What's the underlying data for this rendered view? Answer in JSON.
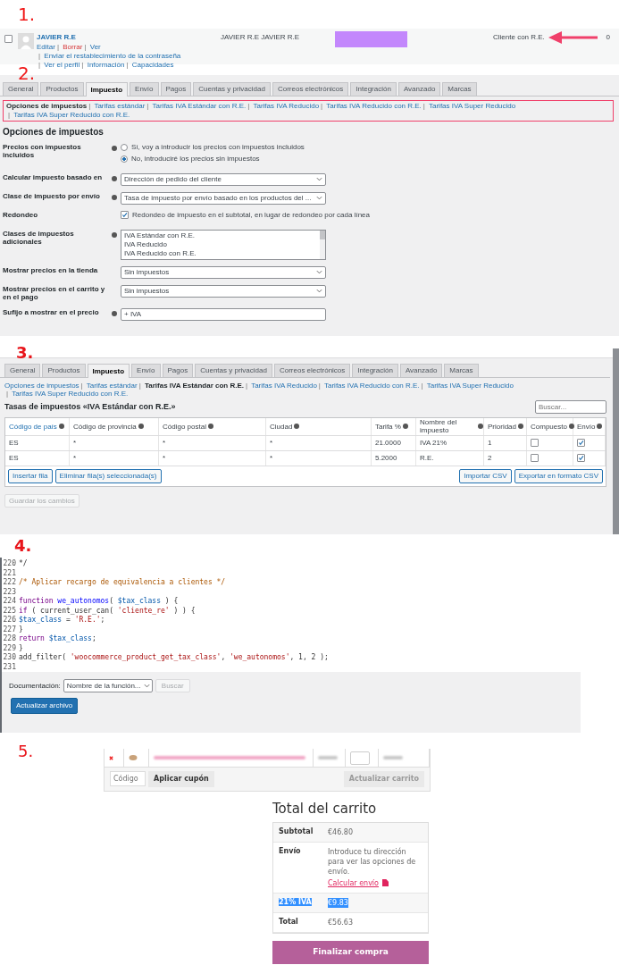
{
  "section_1": {
    "step": "1.",
    "user": {
      "selected": false,
      "name": "JAVIER R.E",
      "separator": "|",
      "actions": [
        {
          "label": "Editar",
          "kind": "link"
        },
        {
          "label": "Borrar",
          "kind": "delete"
        },
        {
          "label": "Ver",
          "kind": "link"
        },
        {
          "label": "Enviar el restablecimiento de la contraseña",
          "kind": "link"
        },
        {
          "label": "Ver el perfil",
          "kind": "link"
        },
        {
          "label": "Información",
          "kind": "link"
        },
        {
          "label": "Capacidades",
          "kind": "link"
        }
      ],
      "full_name": "JAVIER R.E JAVIER R.E",
      "role": "Cliente con R.E.",
      "posts": "0"
    }
  },
  "section_2": {
    "step": "2.",
    "tabs": [
      {
        "label": "General",
        "selected": false
      },
      {
        "label": "Productos",
        "selected": false
      },
      {
        "label": "Impuesto",
        "selected": true
      },
      {
        "label": "Envío",
        "selected": false
      },
      {
        "label": "Pagos",
        "selected": false
      },
      {
        "label": "Cuentas y privacidad",
        "selected": false
      },
      {
        "label": "Correos electrónicos",
        "selected": false
      },
      {
        "label": "Integración",
        "selected": false
      },
      {
        "label": "Avanzado",
        "selected": false
      },
      {
        "label": "Marcas",
        "selected": false
      }
    ],
    "separator": "|",
    "sublinks": [
      {
        "label": "Opciones de impuestos",
        "selected": true
      },
      {
        "label": "Tarifas estándar",
        "selected": false
      },
      {
        "label": "Tarifas IVA Estándar con R.E.",
        "selected": false
      },
      {
        "label": "Tarifas IVA Reducido",
        "selected": false
      },
      {
        "label": "Tarifas IVA Reducido con R.E.",
        "selected": false
      },
      {
        "label": "Tarifas IVA Super Reducido",
        "selected": false
      },
      {
        "label": "Tarifas IVA Super Reducido con R.E.",
        "selected": false
      }
    ],
    "heading": "Opciones de impuestos",
    "fields": [
      {
        "kind": "radio",
        "label": "Precios con impuestos incluidos",
        "help": true,
        "options": [
          {
            "label": "Sí, voy a introducir los precios con impuestos incluidos",
            "selected": false
          },
          {
            "label": "No, introduciré los precios sin impuestos",
            "selected": true
          }
        ]
      },
      {
        "kind": "select",
        "label": "Calcular impuesto basado en",
        "help": true,
        "value": "Dirección de pedido del cliente"
      },
      {
        "kind": "select",
        "label": "Clase de impuesto por envío",
        "help": true,
        "value": "Tasa de impuesto por envío basado en los productos del ..."
      },
      {
        "kind": "checkbox",
        "label": "Redondeo",
        "help": false,
        "checked": true,
        "text": "Redondeo de impuesto en el subtotal, en lugar de redondeo por cada línea"
      },
      {
        "kind": "listbox",
        "label": "Clases de impuestos adicionales",
        "help": true,
        "lines": [
          "IVA Estándar con R.E.",
          "IVA Reducido",
          "IVA Reducido con R.E."
        ]
      },
      {
        "kind": "select",
        "label": "Mostrar precios en la tienda",
        "help": false,
        "value": "Sin impuestos"
      },
      {
        "kind": "select",
        "label": "Mostrar precios en el carrito y en el pago",
        "help": false,
        "value": "Sin impuestos"
      },
      {
        "kind": "text",
        "label": "Sufijo a mostrar en el precio",
        "help": true,
        "value": "+ IVA"
      }
    ]
  },
  "section_3": {
    "step": "3.",
    "tabs": [
      {
        "label": "General",
        "selected": false
      },
      {
        "label": "Productos",
        "selected": false
      },
      {
        "label": "Impuesto",
        "selected": true
      },
      {
        "label": "Envío",
        "selected": false
      },
      {
        "label": "Pagos",
        "selected": false
      },
      {
        "label": "Cuentas y privacidad",
        "selected": false
      },
      {
        "label": "Correos electrónicos",
        "selected": false
      },
      {
        "label": "Integración",
        "selected": false
      },
      {
        "label": "Avanzado",
        "selected": false
      },
      {
        "label": "Marcas",
        "selected": false
      }
    ],
    "separator": "|",
    "sublinks": [
      {
        "label": "Opciones de impuestos",
        "selected": false
      },
      {
        "label": "Tarifas estándar",
        "selected": false
      },
      {
        "label": "Tarifas IVA Estándar con R.E.",
        "selected": true
      },
      {
        "label": "Tarifas IVA Reducido",
        "selected": false
      },
      {
        "label": "Tarifas IVA Reducido con R.E.",
        "selected": false
      },
      {
        "label": "Tarifas IVA Super Reducido",
        "selected": false
      },
      {
        "label": "Tarifas IVA Super Reducido con R.E.",
        "selected": false
      }
    ],
    "heading": "Tasas de impuestos «IVA Estándar con R.E.»",
    "search": {
      "placeholder": "Buscar..."
    },
    "table": {
      "columns": [
        {
          "label": "Código de país",
          "selected": true
        },
        {
          "label": "Código de provincia",
          "selected": false
        },
        {
          "label": "Código postal",
          "selected": false
        },
        {
          "label": "Ciudad",
          "selected": false
        },
        {
          "label": "Tarifa %",
          "selected": false
        },
        {
          "label": "Nombre del impuesto",
          "selected": false
        },
        {
          "label": "Prioridad",
          "selected": false
        },
        {
          "label": "Compuesto",
          "selected": false
        },
        {
          "label": "Envío",
          "selected": false
        }
      ],
      "rows": [
        {
          "country": "ES",
          "state": "*",
          "postcode": "*",
          "city": "*",
          "rate": "21.0000",
          "name": "IVA 21%",
          "priority": "1",
          "compound": false,
          "shipping": true
        },
        {
          "country": "ES",
          "state": "*",
          "postcode": "*",
          "city": "*",
          "rate": "5.2000",
          "name": "R.E.",
          "priority": "2",
          "compound": false,
          "shipping": true
        }
      ]
    },
    "left_buttons": [
      "Insertar fila",
      "Eliminar fila(s) seleccionada(s)"
    ],
    "right_buttons": [
      "Importar CSV",
      "Exportar en formato CSV"
    ],
    "save": {
      "label": "Guardar los cambios",
      "disabled": true
    }
  },
  "section_4": {
    "step": "4.",
    "lines": [
      {
        "number": "220",
        "tokens": [
          {
            "kind": "plain",
            "text": "*/"
          }
        ]
      },
      {
        "number": "221"
      },
      {
        "number": "222",
        "tokens": [
          {
            "kind": "comment",
            "text": "/* Aplicar recargo de equivalencia a clientes */"
          }
        ]
      },
      {
        "number": "223"
      },
      {
        "number": "224",
        "tokens": [
          {
            "kind": "keyword",
            "text": "function "
          },
          {
            "kind": "def",
            "text": "we_autonomos"
          },
          {
            "kind": "plain",
            "text": "( "
          },
          {
            "kind": "variable",
            "text": "$tax_class"
          },
          {
            "kind": "plain",
            "text": " ) {"
          }
        ]
      },
      {
        "number": "225",
        "tokens": [
          {
            "kind": "keyword",
            "text": "if"
          },
          {
            "kind": "plain",
            "text": " ( current_user_can( "
          },
          {
            "kind": "string",
            "text": "'cliente_re'"
          },
          {
            "kind": "plain",
            "text": " ) ) {"
          }
        ]
      },
      {
        "number": "226",
        "tokens": [
          {
            "kind": "variable",
            "text": "$tax_class"
          },
          {
            "kind": "plain",
            "text": " = "
          },
          {
            "kind": "string",
            "text": "'R.E.'"
          },
          {
            "kind": "plain",
            "text": ";"
          }
        ]
      },
      {
        "number": "227",
        "tokens": [
          {
            "kind": "plain",
            "text": "}"
          }
        ]
      },
      {
        "number": "228",
        "tokens": [
          {
            "kind": "keyword",
            "text": "return "
          },
          {
            "kind": "variable",
            "text": "$tax_class"
          },
          {
            "kind": "plain",
            "text": ";"
          }
        ]
      },
      {
        "number": "229",
        "tokens": [
          {
            "kind": "plain",
            "text": "}"
          }
        ]
      },
      {
        "number": "230",
        "tokens": [
          {
            "kind": "plain",
            "text": "add_filter( "
          },
          {
            "kind": "string",
            "text": "'woocommerce_product_get_tax_class'"
          },
          {
            "kind": "plain",
            "text": ", "
          },
          {
            "kind": "string",
            "text": "'we_autonomos'"
          },
          {
            "kind": "plain",
            "text": ", 1, 2 );"
          }
        ]
      },
      {
        "number": "231"
      }
    ],
    "doc_label": "Documentación:",
    "doc_select": "Nombre de la función...",
    "search_button": {
      "label": "Buscar",
      "disabled": true
    },
    "update_button": "Actualizar archivo"
  },
  "section_5": {
    "step": "5.",
    "coupon": {
      "placeholder": "Código"
    },
    "apply_button": "Aplicar cupón",
    "update_button": {
      "label": "Actualizar carrito",
      "disabled": true
    },
    "title": "Total del carrito",
    "totals": [
      {
        "kind": "amount",
        "label": "Subtotal",
        "value": "€46.80",
        "highlighted": false
      },
      {
        "kind": "shipping",
        "label": "Envío",
        "value": "Introduce tu dirección para ver las opciones de envío.",
        "link": "Calcular envío",
        "highlighted": false
      },
      {
        "kind": "amount",
        "label": "21% IVA",
        "value": "€9.83",
        "highlighted": true
      },
      {
        "kind": "amount",
        "label": "Total",
        "value": "€56.63",
        "highlighted": false
      }
    ],
    "checkout_button": "Finalizar compra"
  }
}
